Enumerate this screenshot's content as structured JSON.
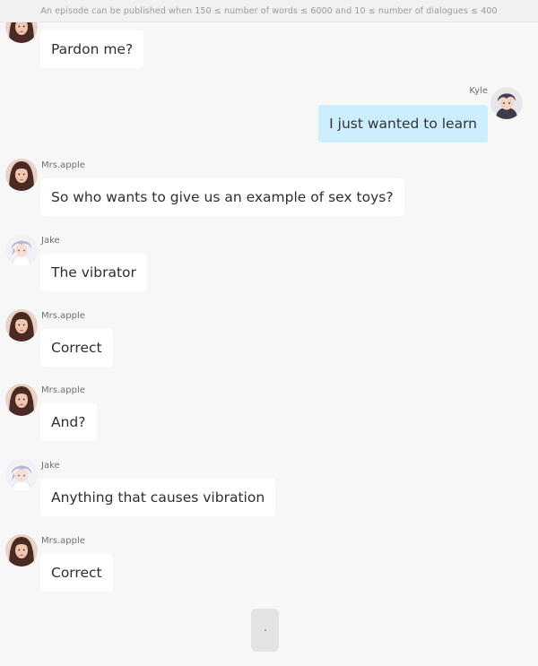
{
  "notice": "An episode can be published when 150 ≤ number of words ≤ 6000 and 10 ≤ number of dialogues ≤ 400",
  "messages": [
    {
      "speaker": "",
      "text": "Pardon me?",
      "side": "left",
      "avatar": "mrs-apple-avatar"
    },
    {
      "speaker": "Kyle",
      "text": "I just wanted to learn",
      "side": "right",
      "avatar": "kyle-avatar"
    },
    {
      "speaker": "Mrs.apple",
      "text": "So who wants to give us an example of sex toys?",
      "side": "left",
      "avatar": "mrs-apple-avatar"
    },
    {
      "speaker": "Jake",
      "text": "The vibrator",
      "side": "left",
      "avatar": "jake-avatar"
    },
    {
      "speaker": "Mrs.apple",
      "text": "Correct",
      "side": "left",
      "avatar": "mrs-apple-avatar"
    },
    {
      "speaker": "Mrs.apple",
      "text": "And?",
      "side": "left",
      "avatar": "mrs-apple-avatar"
    },
    {
      "speaker": "Jake",
      "text": "Anything that causes vibration",
      "side": "left",
      "avatar": "jake-avatar"
    },
    {
      "speaker": "Mrs.apple",
      "text": "Correct",
      "side": "left",
      "avatar": "mrs-apple-avatar"
    }
  ],
  "colors": {
    "background": "#f7f7f7",
    "left_bubble": "#ffffff",
    "right_bubble": "#cdeefc",
    "text": "#2e2e2e",
    "speaker_name": "#6e6e6e"
  },
  "compose_button_icon": "dot-icon"
}
